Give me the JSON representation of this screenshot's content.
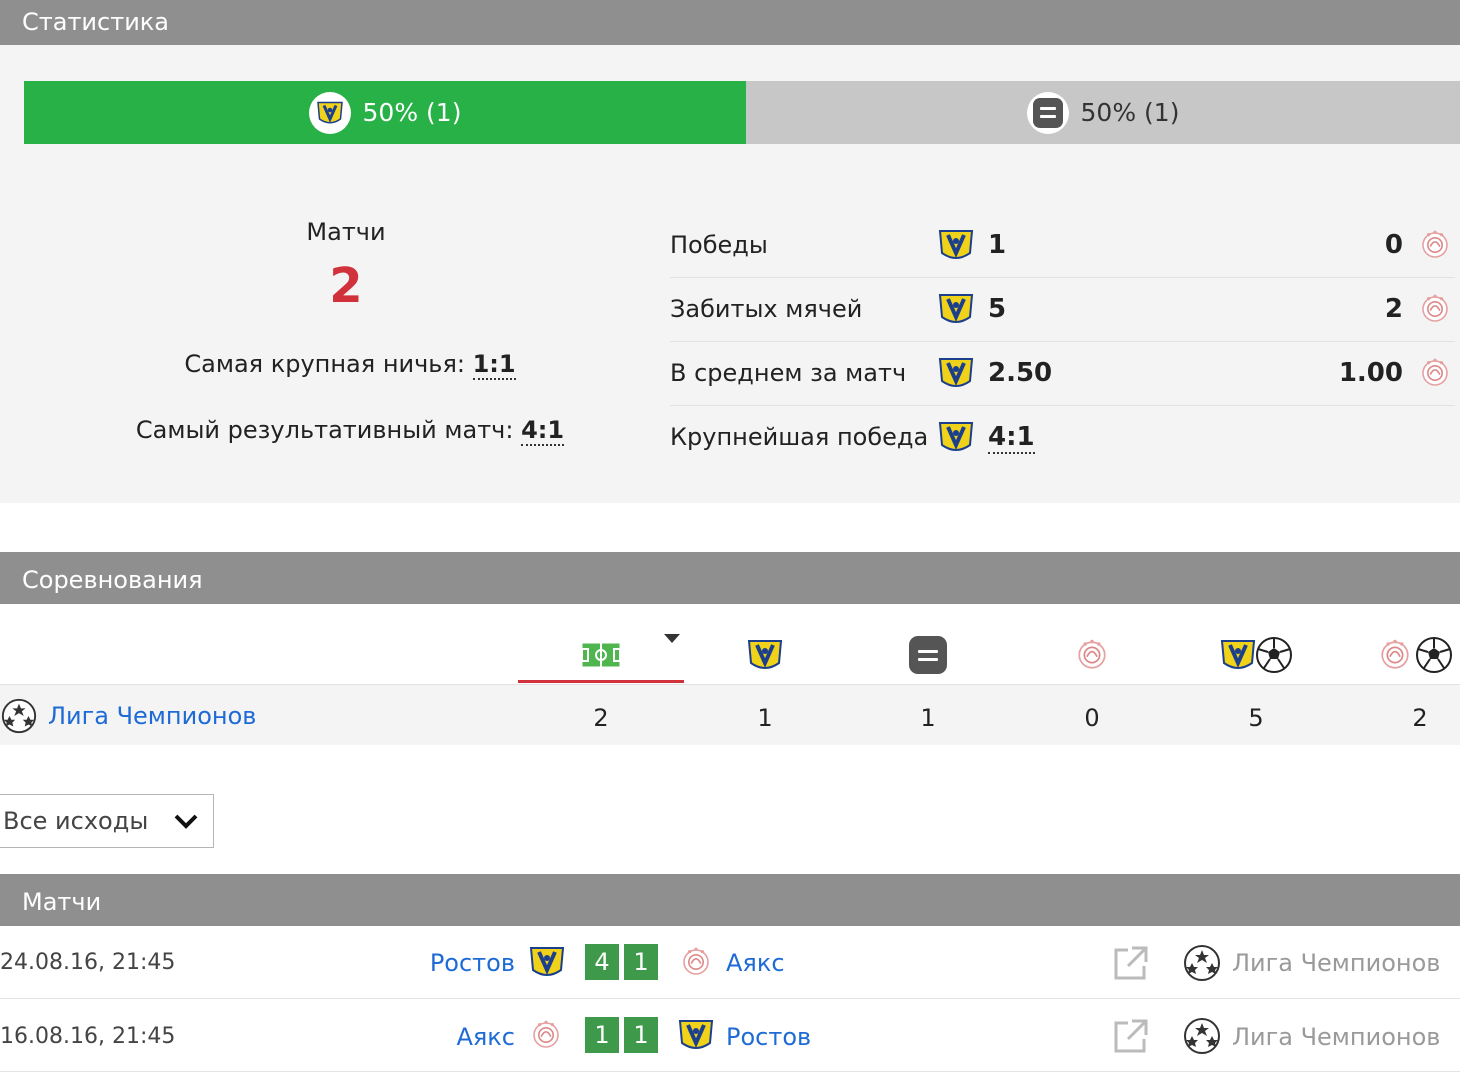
{
  "stats_section": {
    "title": "Статистика",
    "bar": {
      "home_label": "50% (1)",
      "draw_label": "50% (1)",
      "home_fraction": 0.5
    },
    "matches_label": "Матчи",
    "matches_count": "2",
    "biggest_draw_label": "Самая крупная ничья:",
    "biggest_draw_value": "1:1",
    "top_scoring_label": "Самый результативный матч:",
    "top_scoring_value": "4:1",
    "rows": [
      {
        "label": "Победы",
        "home": "1",
        "away": "0"
      },
      {
        "label": "Забитых мячей",
        "home": "5",
        "away": "2"
      },
      {
        "label": "В среднем за матч",
        "home": "2.50",
        "away": "1.00"
      },
      {
        "label": "Крупнейшая победа",
        "home": "4:1",
        "away": ""
      }
    ]
  },
  "competitions_section": {
    "title": "Соревнования",
    "columns": [
      "field-icon",
      "rostov-crest-icon",
      "draw-icon",
      "ajax-crest-icon",
      "rostov-goals-icon",
      "ajax-goals-icon"
    ],
    "rows": [
      {
        "name": "Лига Чемпионов",
        "values": [
          "2",
          "1",
          "1",
          "0",
          "5",
          "2"
        ]
      }
    ]
  },
  "filter": {
    "selected": "Все исходы"
  },
  "matches_section": {
    "title": "Матчи",
    "rows": [
      {
        "date": "24.08.16, 21:45",
        "home": "Ростов",
        "away": "Аякс",
        "home_score": "4",
        "away_score": "1",
        "competition": "Лига Чемпионов"
      },
      {
        "date": "16.08.16, 21:45",
        "home": "Аякс",
        "away": "Ростов",
        "home_score": "1",
        "away_score": "1",
        "competition": "Лига Чемпионов"
      }
    ]
  },
  "colors": {
    "header": "#8f8f8f",
    "win_bar": "#27b146",
    "draw_bar": "#c7c7c7",
    "count": "#d0313a",
    "link": "#1e6bd6",
    "score_bg": "#3e9a4a"
  }
}
